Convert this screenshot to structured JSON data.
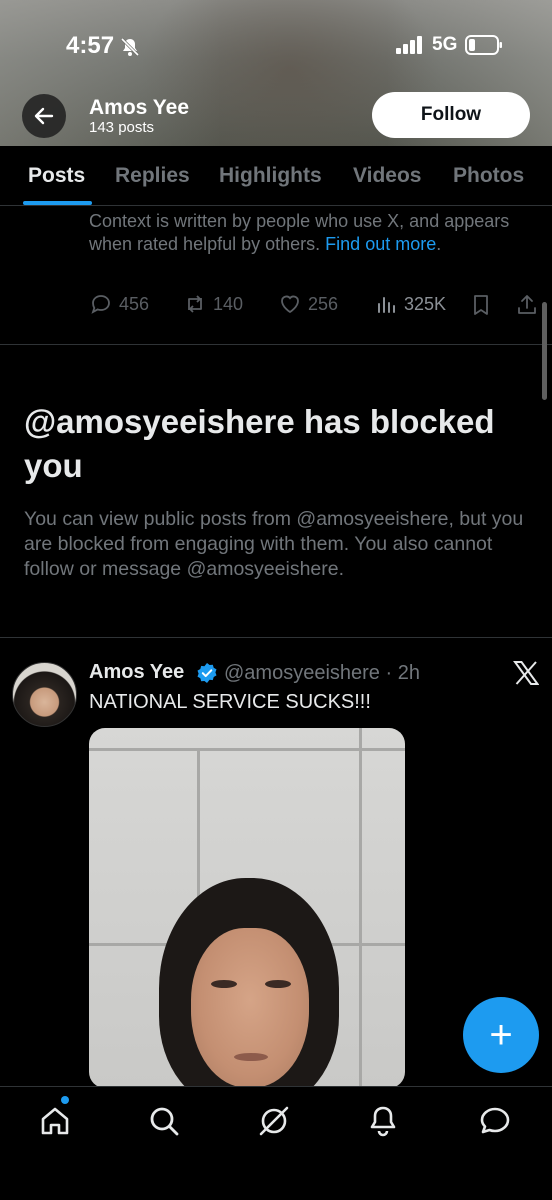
{
  "status_bar": {
    "time": "4:57",
    "network": "5G",
    "icons": [
      "bell-slash-icon",
      "signal-icon",
      "battery-icon"
    ]
  },
  "header": {
    "name": "Amos Yee",
    "post_count": "143 posts",
    "follow_label": "Follow",
    "back_icon": "arrow-left-icon"
  },
  "tabs": [
    {
      "label": "Posts",
      "active": true
    },
    {
      "label": "Replies",
      "active": false
    },
    {
      "label": "Highlights",
      "active": false
    },
    {
      "label": "Videos",
      "active": false
    },
    {
      "label": "Photos",
      "active": false
    }
  ],
  "note": {
    "text": "Context is written by people who use X, and appears when rated helpful by others.",
    "link": "Find out more",
    "period": "."
  },
  "actions": {
    "replies": "456",
    "reposts": "140",
    "likes": "256",
    "views": "325K"
  },
  "blocked": {
    "title": "@amosyeeishere has blocked you",
    "body": "You can view public posts from @amosyeeishere, but you are blocked from engaging with them. You also cannot follow or message @amosyeeishere."
  },
  "post": {
    "author": "Amos Yee",
    "handle": "@amosyeeishere",
    "time": "· 2h",
    "text": "NATIONAL SERVICE SUCKS!!!"
  },
  "fab_label": "+",
  "colors": {
    "accent": "#1d9bf0",
    "background": "#000000",
    "muted": "#71767b"
  },
  "bottom_nav": [
    "home-icon",
    "search-icon",
    "grok-icon",
    "notifications-icon",
    "messages-icon"
  ]
}
